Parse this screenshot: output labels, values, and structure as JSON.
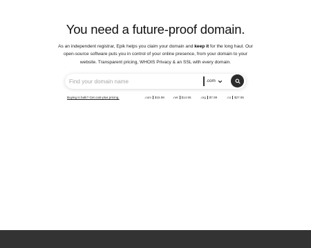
{
  "hero": {
    "headline": "You need a future-proof domain.",
    "lead_part1": "As an independent registrar, Epik helps you claim your domain and ",
    "lead_bold": "keep it",
    "lead_part2": " for the long haul. Our open-source software puts you in control of your online presence, from your domain to your website. Transparent pricing, WHOIS Privacy & an SSL with every domain."
  },
  "search": {
    "placeholder": "Find your domain name",
    "value": "",
    "tld_selected": ".com",
    "chevron_icon": "chevron-down-icon",
    "button_icon": "search-icon"
  },
  "bulk_link": "Buying in bulk? Get cost-plus pricing.",
  "prices": [
    {
      "tld": ".com",
      "price": "$15.99"
    },
    {
      "tld": ".net",
      "price": "$14.95"
    },
    {
      "tld": ".org",
      "price": "$7.89"
    },
    {
      "tld": ".co",
      "price": "$27.95"
    }
  ],
  "colors": {
    "background": "#ffffff",
    "footer": "#333333",
    "search_button": "#2b2b2b",
    "text": "#1a1a1a"
  }
}
